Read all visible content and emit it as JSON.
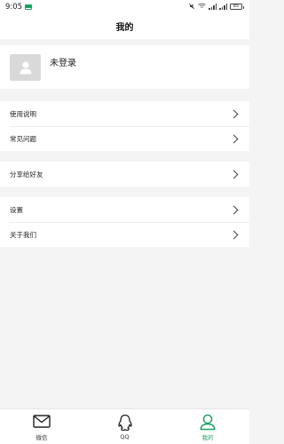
{
  "status_bar": {
    "time": "9:05",
    "battery": "85"
  },
  "header": {
    "title": "我的"
  },
  "profile": {
    "name": "未登录"
  },
  "groups": [
    {
      "items": [
        {
          "label": "使用说明"
        },
        {
          "label": "常见问题"
        }
      ]
    },
    {
      "items": [
        {
          "label": "分享给好友"
        }
      ]
    },
    {
      "items": [
        {
          "label": "设置"
        },
        {
          "label": "关于我们"
        }
      ]
    }
  ],
  "tabs": [
    {
      "label": "微信",
      "icon": "mail-icon",
      "active": false
    },
    {
      "label": "QQ",
      "icon": "qq-penguin-icon",
      "active": false
    },
    {
      "label": "我的",
      "icon": "person-icon",
      "active": true
    }
  ],
  "colors": {
    "accent": "#1aa260",
    "background": "#f4f4f4",
    "text": "#222222"
  }
}
